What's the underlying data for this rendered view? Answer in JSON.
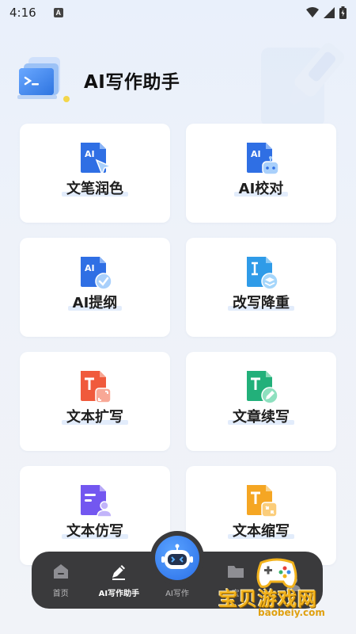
{
  "status_bar": {
    "time": "4:16",
    "notification_icon": "A"
  },
  "header": {
    "title": "AI写作助手"
  },
  "tools": [
    {
      "label": "文笔润色",
      "icon": "ai-doc-cursor-icon",
      "color": "#2f6fe4"
    },
    {
      "label": "AI校对",
      "icon": "ai-doc-robot-icon",
      "color": "#2f6fe4"
    },
    {
      "label": "AI提纲",
      "icon": "ai-doc-check-icon",
      "color": "#2f6fe4"
    },
    {
      "label": "改写降重",
      "icon": "text-doc-layers-icon",
      "color": "#2f9be8"
    },
    {
      "label": "文本扩写",
      "icon": "text-doc-expand-icon",
      "color": "#f05a3c"
    },
    {
      "label": "文章续写",
      "icon": "text-doc-edit-icon",
      "color": "#22b07a"
    },
    {
      "label": "文本仿写",
      "icon": "text-doc-person-icon",
      "color": "#7357f0"
    },
    {
      "label": "文本缩写",
      "icon": "text-doc-shrink-icon",
      "color": "#f5a623"
    }
  ],
  "bottom_nav": {
    "items": [
      {
        "label": "首页",
        "icon": "home-icon",
        "active": false
      },
      {
        "label": "AI写作助手",
        "icon": "pen-icon",
        "active": true
      },
      {
        "label": "AI写作",
        "icon": "robot-icon",
        "active": false
      },
      {
        "label": "宝",
        "icon": "folder-icon",
        "active": false
      },
      {
        "label": "",
        "icon": "user-icon",
        "active": false
      }
    ]
  },
  "watermark": {
    "title": "宝贝游戏网",
    "url": "baobeiy.com"
  }
}
